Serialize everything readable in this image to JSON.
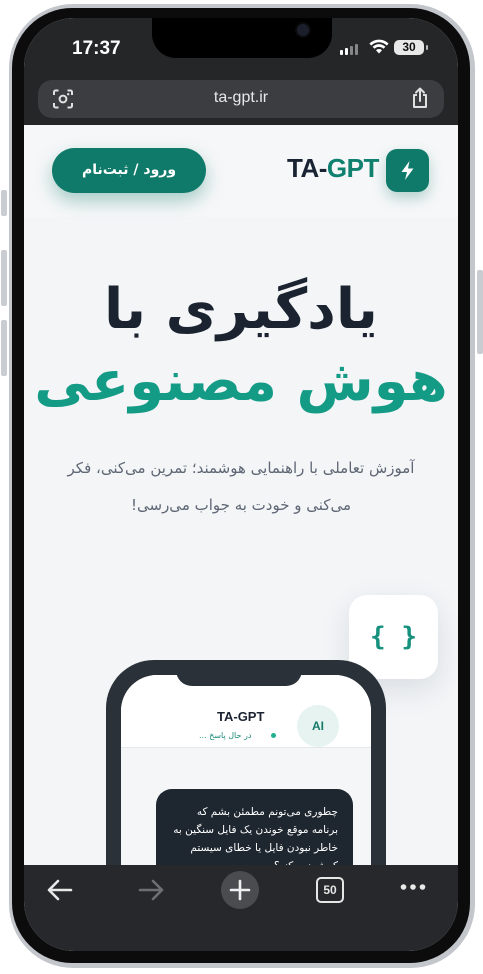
{
  "status_bar": {
    "time": "17:37",
    "battery": "30"
  },
  "browser": {
    "url": "ta-gpt.ir",
    "tab_count": "50"
  },
  "header": {
    "login_label": "ورود / ثبت‌نام",
    "brand_prefix": "TA-",
    "brand_suffix": "GPT"
  },
  "hero": {
    "line1": "یادگیری با",
    "line2": "هوش مصنوعی",
    "subtitle": "آموزش تعاملی با راهنمایی هوشمند؛ تمرین می‌کنی، فکر می‌کنی و خودت به جواب می‌رسی!"
  },
  "code_badge": "{ }",
  "mockup": {
    "title": "TA-GPT",
    "status": "در حال پاسخ ...",
    "avatar": "AI",
    "message": "چطوری می‌تونم مطمئن بشم که برنامه موقع خوندن یک فایل سنگین به خاطر نبودن فایل یا خطای سیستم کرش نمی‌کنه؟"
  },
  "colors": {
    "brand": "#0f7a6a",
    "accent": "#149b86",
    "dark": "#1b2230"
  },
  "icons": [
    "lens-icon",
    "share-icon",
    "bolt-icon",
    "back-icon",
    "forward-icon",
    "new-tab-icon",
    "tabs-icon",
    "more-icon"
  ]
}
